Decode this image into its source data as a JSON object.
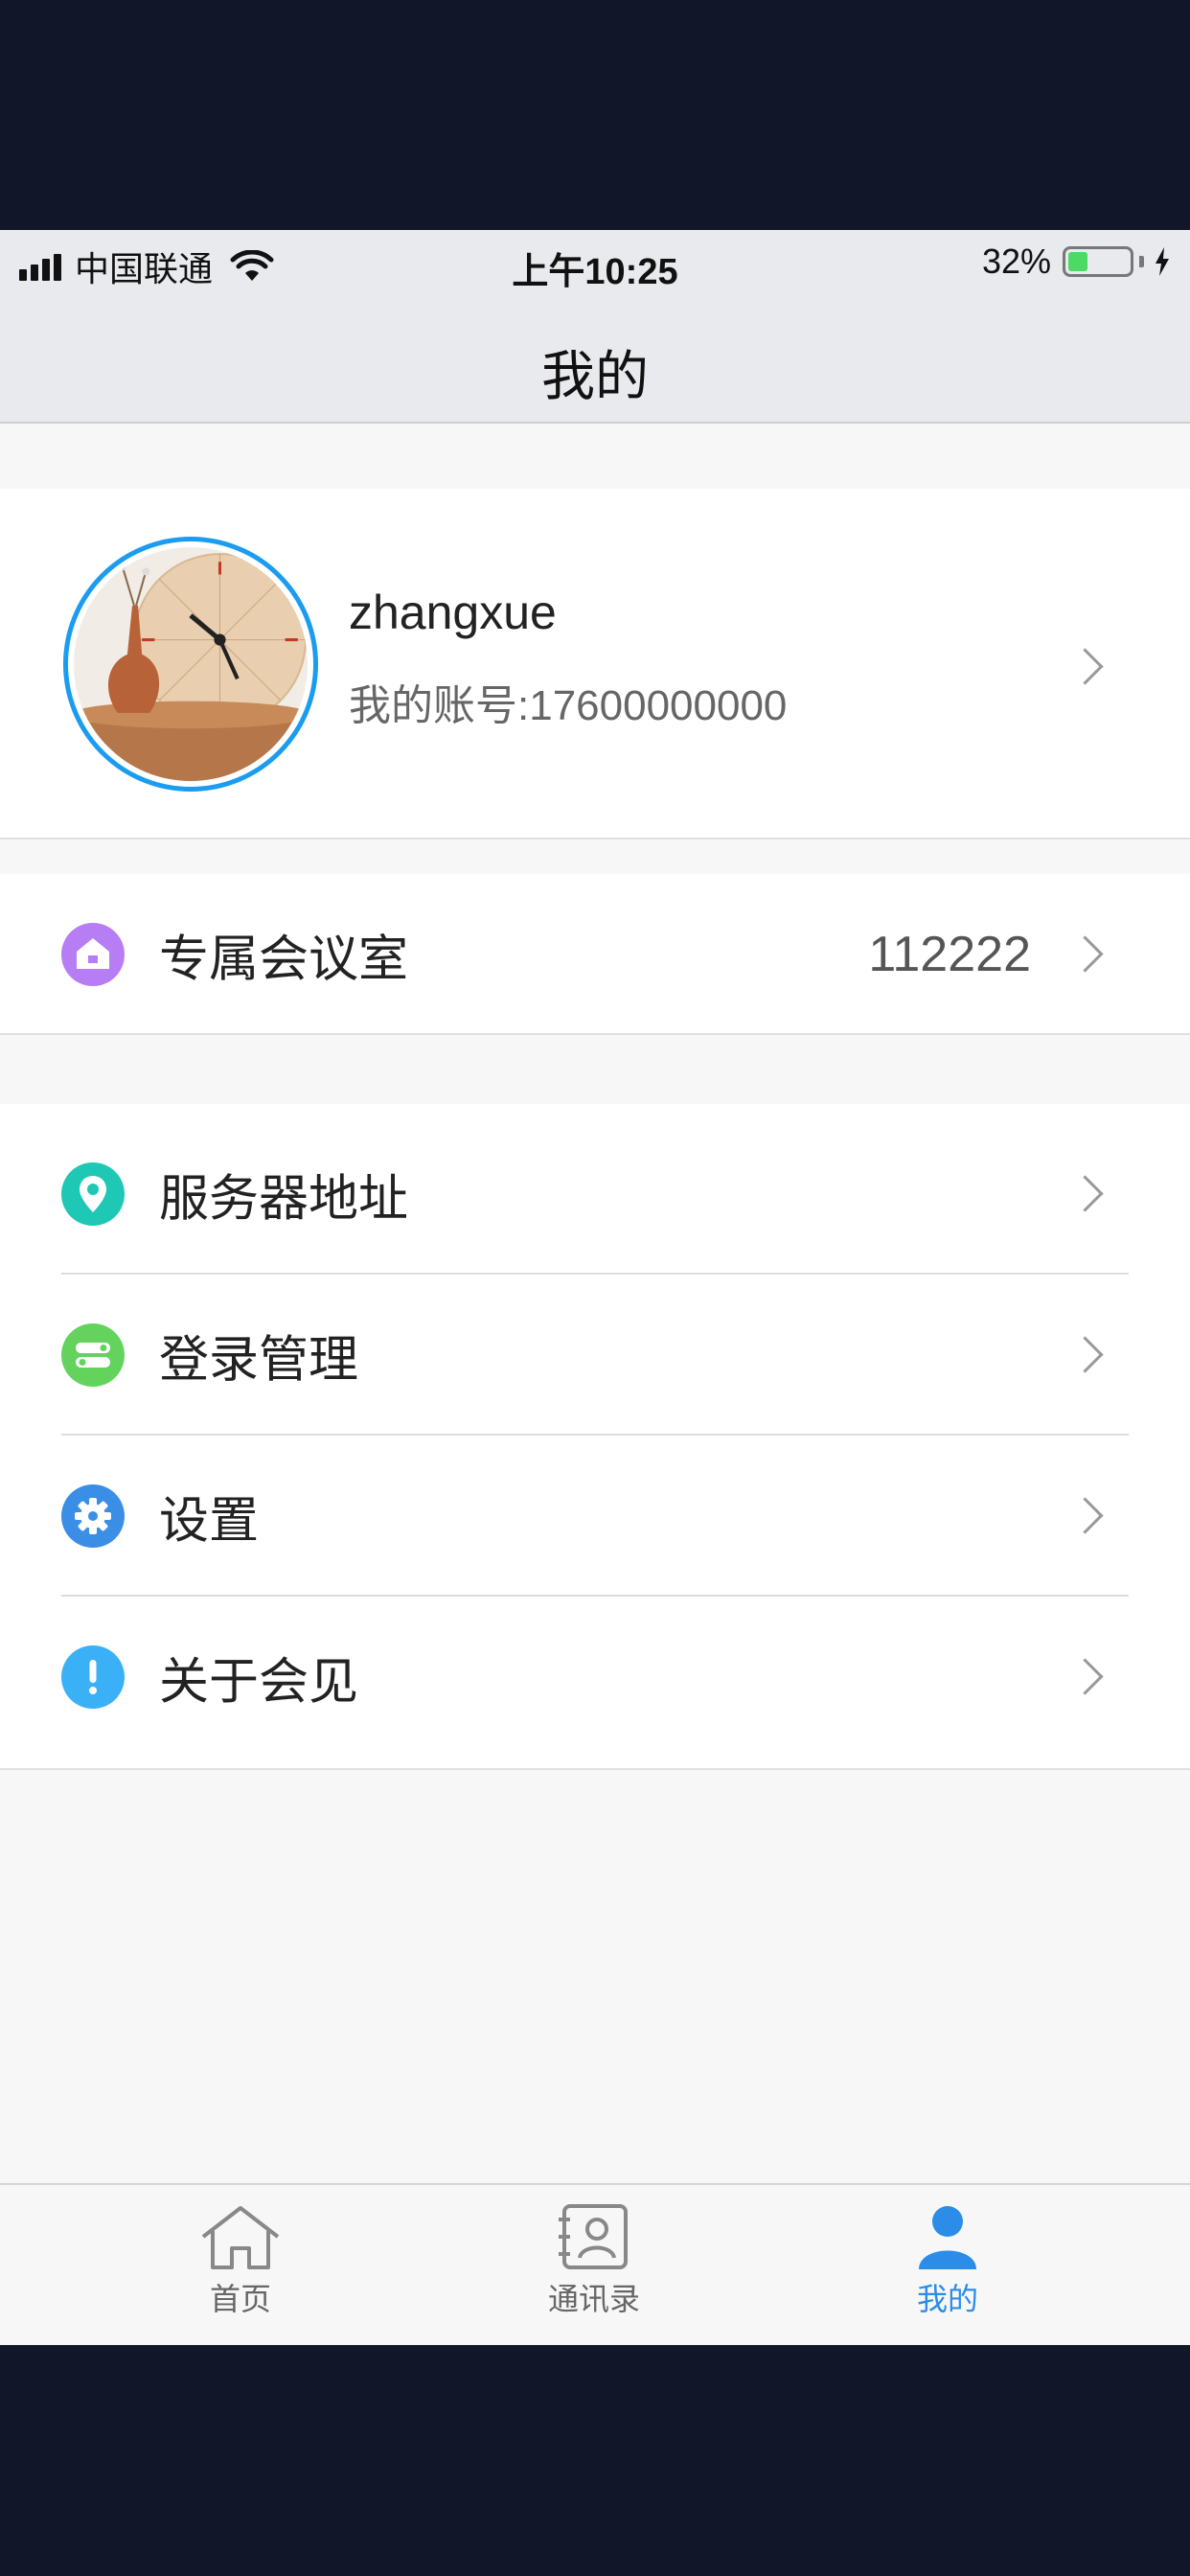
{
  "status_bar": {
    "carrier": "中国联通",
    "time": "上午10:25",
    "battery_percent": "32%",
    "battery_level": 0.32
  },
  "nav": {
    "title": "我的"
  },
  "profile": {
    "username": "zhangxue",
    "account": "我的账号:17600000000"
  },
  "meeting_room": {
    "label": "专属会议室",
    "value": "112222",
    "icon": "house-icon",
    "color": "#b77df5"
  },
  "menu": [
    {
      "label": "服务器地址",
      "icon": "location-pin-icon",
      "color": "#1ec8b4"
    },
    {
      "label": "登录管理",
      "icon": "toggle-icon",
      "color": "#63d35e"
    },
    {
      "label": "设置",
      "icon": "gear-icon",
      "color": "#3a8ee6"
    },
    {
      "label": "关于会见",
      "icon": "info-icon",
      "color": "#3ab1f7"
    }
  ],
  "tabs": [
    {
      "label": "首页",
      "icon": "home-icon",
      "active": false
    },
    {
      "label": "通讯录",
      "icon": "contacts-icon",
      "active": false
    },
    {
      "label": "我的",
      "icon": "person-icon",
      "active": true
    }
  ],
  "colors": {
    "accent": "#2b8de8",
    "background": "#111729",
    "avatar_ring": "#1a9cf0"
  }
}
